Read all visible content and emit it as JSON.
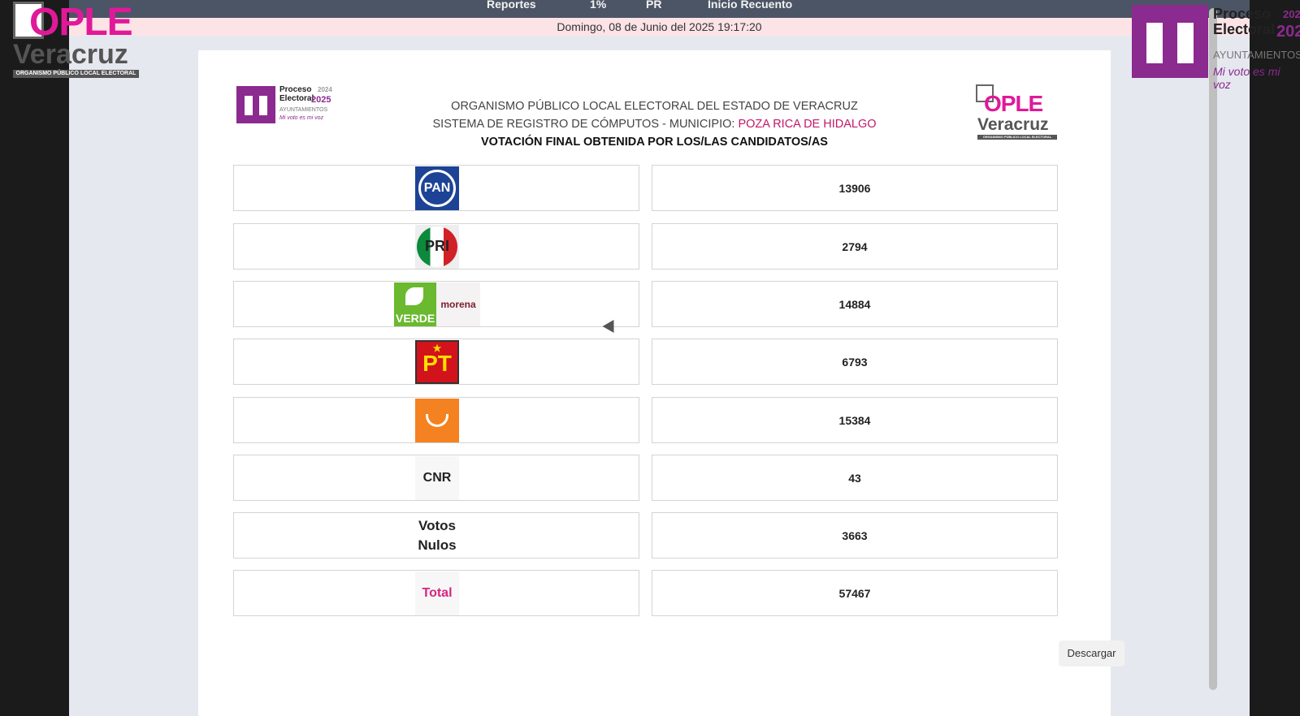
{
  "nav": {
    "items": [
      "Reportes",
      "1%",
      "PR",
      "Inicio Recuento"
    ]
  },
  "datetime": "Domingo, 08 de Junio del 2025 19:17:20",
  "corner_logos": {
    "ople_word": "OPLE",
    "ople_city": "Veracruz",
    "ople_strip": "ORGANISMO PÚBLICO LOCAL ELECTORAL",
    "proceso_lines": [
      "Proceso",
      "Electoral"
    ],
    "proceso_years": [
      "2024",
      "2025"
    ],
    "ayuntamientos": "AYUNTAMIENTOS",
    "motto": "Mi voto es mi voz"
  },
  "header": {
    "line1": "ORGANISMO PÚBLICO LOCAL ELECTORAL DEL ESTADO DE VERACRUZ",
    "line2_prefix": "SISTEMA DE REGISTRO DE CÓMPUTOS - MUNICIPIO:",
    "municipio": "POZA RICA DE HIDALGO",
    "line3": "VOTACIÓN FINAL OBTENIDA POR LOS/LAS CANDIDATOS/AS"
  },
  "results": [
    {
      "logo": "PAN",
      "votes": "13906"
    },
    {
      "logo": "PRI",
      "votes": "2794"
    },
    {
      "logo_left": "VERDE",
      "logo_right": "morena",
      "votes": "14884"
    },
    {
      "logo": "PT",
      "votes": "6793"
    },
    {
      "logo": "MOVIMIENTO CIUDADANO",
      "votes": "15384"
    },
    {
      "logo": "CNR",
      "votes": "43"
    },
    {
      "logo_lines": [
        "Votos",
        "Nulos"
      ],
      "votes": "3663"
    },
    {
      "logo": "Total",
      "votes": "57467"
    }
  ],
  "download_label": "Descargar",
  "colors": {
    "accent_pink": "#e0199a",
    "purple": "#8b2a8f",
    "nav_bg": "#4c5565",
    "date_bg": "#fbe3e6"
  }
}
